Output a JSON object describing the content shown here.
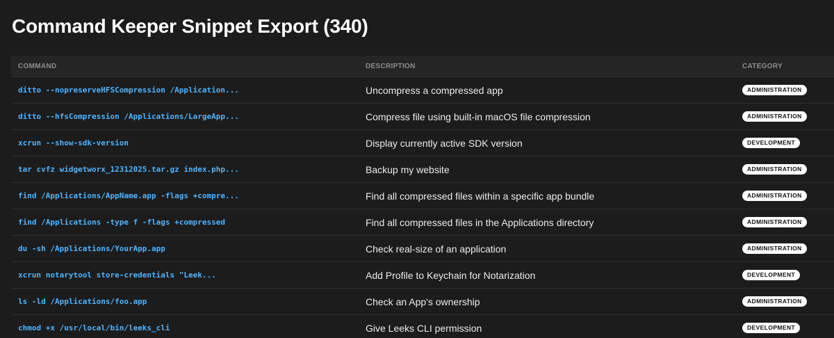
{
  "page": {
    "title": "Command Keeper Snippet Export (340)"
  },
  "table": {
    "headers": {
      "command": "COMMAND",
      "description": "DESCRIPTION",
      "category": "CATEGORY"
    },
    "rows": [
      {
        "command": "ditto --nopreserveHFSCompression /Application...",
        "description": "Uncompress a compressed app",
        "category": "ADMINISTRATION"
      },
      {
        "command": "ditto --hfsCompression /Applications/LargeApp...",
        "description": "Compress file using built-in macOS file compression",
        "category": "ADMINISTRATION"
      },
      {
        "command": "xcrun --show-sdk-version",
        "description": "Display currently active SDK version",
        "category": "DEVELOPMENT"
      },
      {
        "command": "tar cvfz widgetworx_12312025.tar.gz index.php...",
        "description": "Backup my website",
        "category": "ADMINISTRATION"
      },
      {
        "command": "find /Applications/AppName.app -flags +compre...",
        "description": "Find all compressed files within a specific app bundle",
        "category": "ADMINISTRATION"
      },
      {
        "command": "find /Applications -type f -flags +compressed",
        "description": "Find all compressed files in the Applications directory",
        "category": "ADMINISTRATION"
      },
      {
        "command": "du -sh /Applications/YourApp.app",
        "description": "Check real-size of an application",
        "category": "ADMINISTRATION"
      },
      {
        "command": "xcrun notarytool store-credentials \"Leek...",
        "description": "Add Profile to Keychain for Notarization",
        "category": "DEVELOPMENT"
      },
      {
        "command": "ls -ld /Applications/foo.app",
        "description": "Check an App's ownership",
        "category": "ADMINISTRATION"
      },
      {
        "command": "chmod +x /usr/local/bin/leeks_cli",
        "description": "Give Leeks CLI permission",
        "category": "DEVELOPMENT"
      }
    ]
  }
}
